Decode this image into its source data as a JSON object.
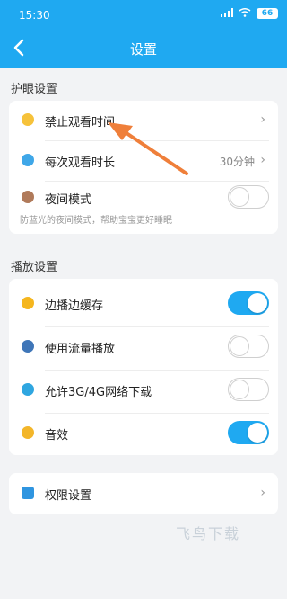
{
  "status_bar": {
    "time": "15:30",
    "battery": "66"
  },
  "header": {
    "title": "设置",
    "back_icon": "chevron-left-icon"
  },
  "colors": {
    "accent": "#1fa9f1",
    "annotation_arrow": "#ef7f3a"
  },
  "eye_section": {
    "label": "护眼设置",
    "items": [
      {
        "label": "禁止观看时间",
        "icon": "moon-icon",
        "icon_color": "#f6c23a"
      },
      {
        "label": "每次观看时长",
        "value": "30分钟",
        "icon": "clock-icon",
        "icon_color": "#3fa7e8"
      },
      {
        "label": "夜间模式",
        "icon": "night-icon",
        "icon_color": "#b07a5a",
        "toggle": false
      }
    ],
    "hint": "防蓝光的夜间模式，帮助宝宝更好睡眠"
  },
  "play_section": {
    "label": "播放设置",
    "items": [
      {
        "label": "边播边缓存",
        "icon": "cache-icon",
        "icon_color": "#f5b61e",
        "toggle": true
      },
      {
        "label": "使用流量播放",
        "icon": "data-icon",
        "icon_color": "#3f76b8",
        "toggle": false
      },
      {
        "label": "允许3G/4G网络下载",
        "icon": "globe-icon",
        "icon_color": "#2fa6e0",
        "toggle": false
      },
      {
        "label": "音效",
        "icon": "bell-icon",
        "icon_color": "#f3b62a",
        "toggle": true
      }
    ]
  },
  "permissions": {
    "label": "权限设置",
    "icon": "shield-icon",
    "icon_color": "#2f95e0"
  },
  "watermark": "飞鸟下载"
}
